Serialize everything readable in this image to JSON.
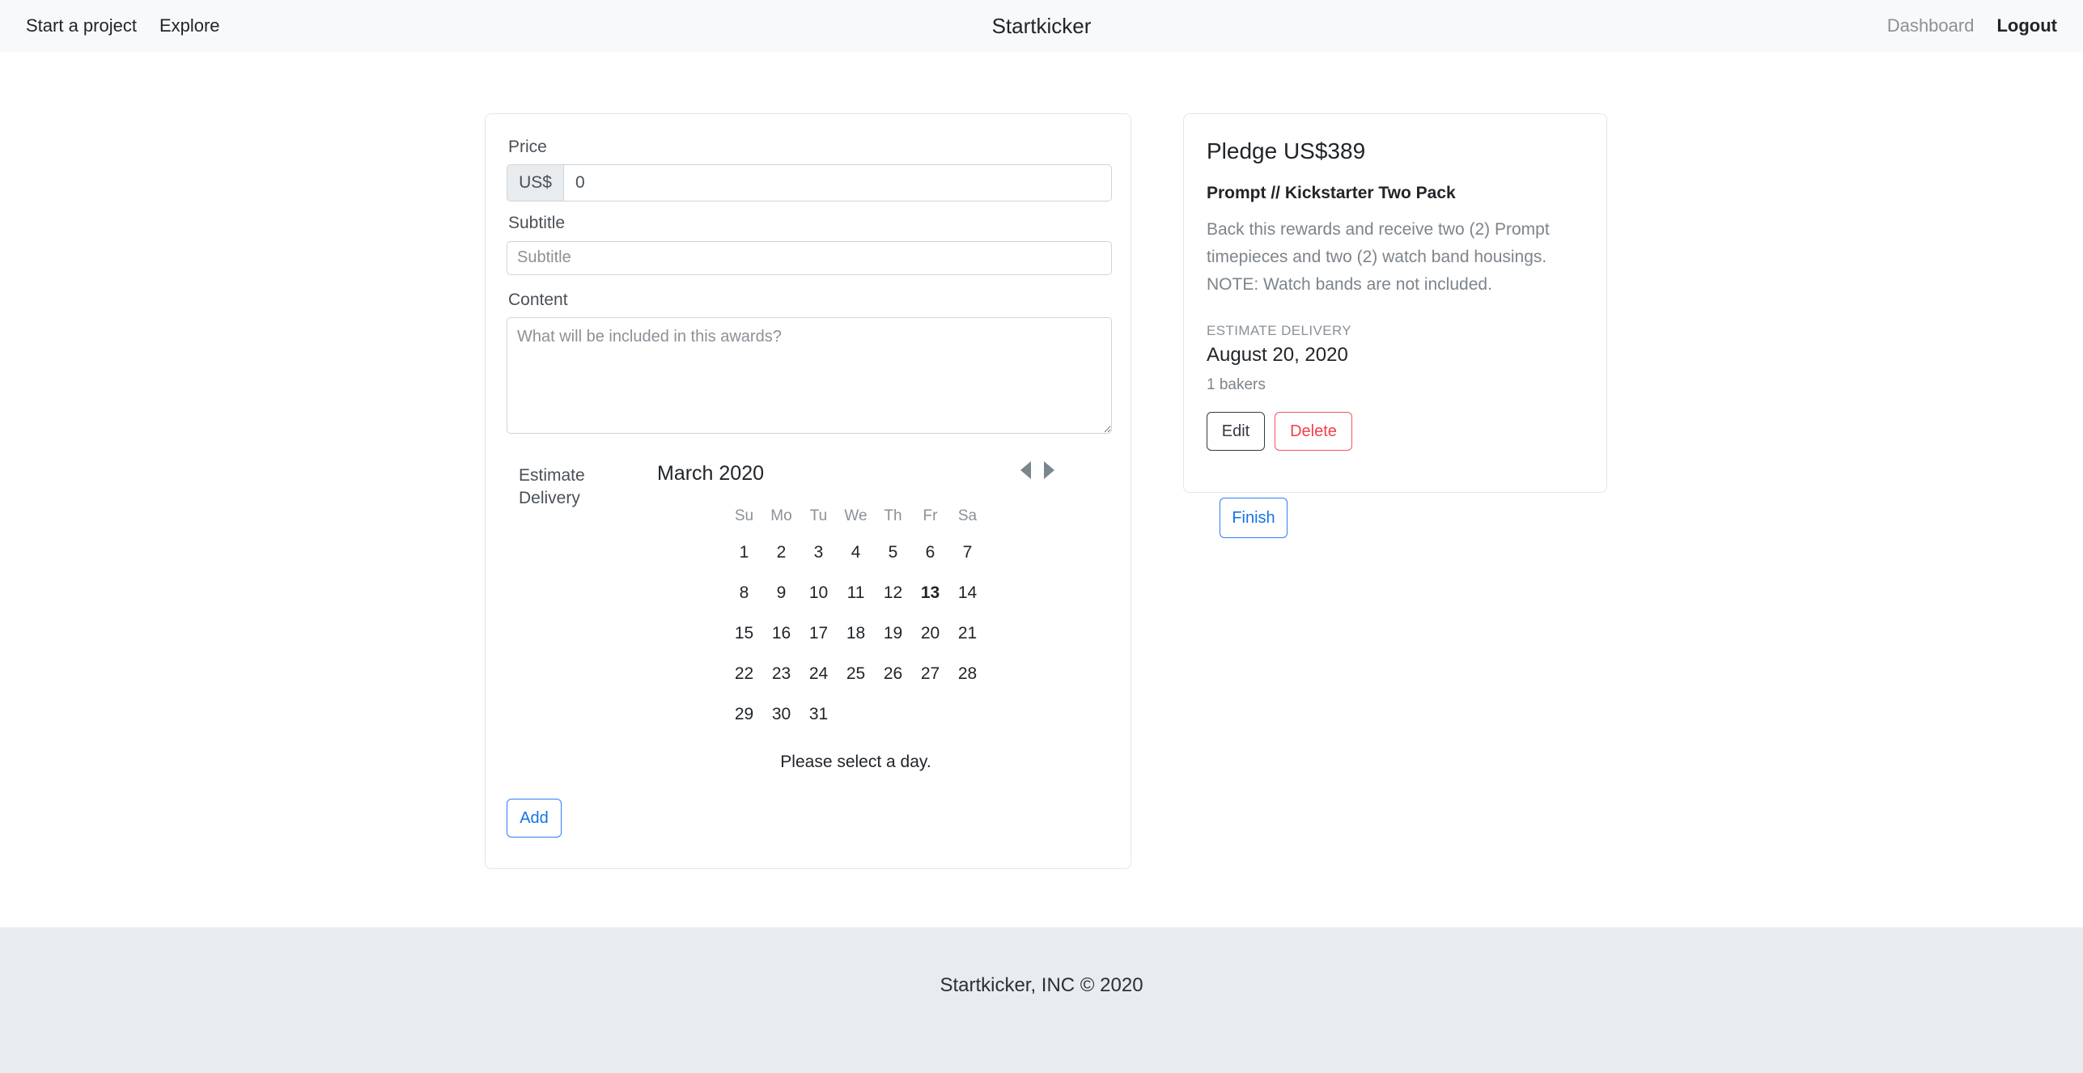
{
  "navbar": {
    "brand": "Startkicker",
    "left_links": [
      {
        "label": "Start a project",
        "name": "nav-start-a-project"
      },
      {
        "label": "Explore",
        "name": "nav-explore"
      }
    ],
    "right_links": [
      {
        "label": "Dashboard",
        "name": "nav-dashboard",
        "style": "muted"
      },
      {
        "label": "Logout",
        "name": "nav-logout",
        "style": "strong"
      }
    ]
  },
  "form": {
    "price_label": "Price",
    "price_prefix": "US$",
    "price_value": "0",
    "price_placeholder": "0",
    "subtitle_label": "Subtitle",
    "subtitle_value": "",
    "subtitle_placeholder": "Subtitle",
    "content_label": "Content",
    "content_value": "",
    "content_placeholder": "What will be included in this awards?",
    "delivery_label": "Estimate Delivery",
    "add_label": "Add"
  },
  "datepicker": {
    "caption": "March 2020",
    "prev_label": "Previous Month",
    "next_label": "Next Month",
    "weekdays": [
      "Su",
      "Mo",
      "Tu",
      "We",
      "Th",
      "Fr",
      "Sa"
    ],
    "footer_text": "Please select a day.",
    "today": 13,
    "first_enabled_day": 13,
    "leading_blanks": 0,
    "days_in_month": 31,
    "weeks": [
      [
        {
          "d": "1",
          "state": "disabled"
        },
        {
          "d": "2",
          "state": "disabled"
        },
        {
          "d": "3",
          "state": "disabled"
        },
        {
          "d": "4",
          "state": "disabled"
        },
        {
          "d": "5",
          "state": "disabled"
        },
        {
          "d": "6",
          "state": "disabled"
        },
        {
          "d": "7",
          "state": "disabled"
        }
      ],
      [
        {
          "d": "8",
          "state": "disabled"
        },
        {
          "d": "9",
          "state": "disabled"
        },
        {
          "d": "10",
          "state": "disabled"
        },
        {
          "d": "11",
          "state": "disabled"
        },
        {
          "d": "12",
          "state": "disabled"
        },
        {
          "d": "13",
          "state": "today"
        },
        {
          "d": "14",
          "state": "normal"
        }
      ],
      [
        {
          "d": "15",
          "state": "normal"
        },
        {
          "d": "16",
          "state": "normal"
        },
        {
          "d": "17",
          "state": "normal"
        },
        {
          "d": "18",
          "state": "normal"
        },
        {
          "d": "19",
          "state": "normal"
        },
        {
          "d": "20",
          "state": "normal"
        },
        {
          "d": "21",
          "state": "normal"
        }
      ],
      [
        {
          "d": "22",
          "state": "normal"
        },
        {
          "d": "23",
          "state": "normal"
        },
        {
          "d": "24",
          "state": "normal"
        },
        {
          "d": "25",
          "state": "normal"
        },
        {
          "d": "26",
          "state": "normal"
        },
        {
          "d": "27",
          "state": "normal"
        },
        {
          "d": "28",
          "state": "normal"
        }
      ],
      [
        {
          "d": "29",
          "state": "normal"
        },
        {
          "d": "30",
          "state": "normal"
        },
        {
          "d": "31",
          "state": "normal"
        },
        {
          "d": "",
          "state": "empty"
        },
        {
          "d": "",
          "state": "empty"
        },
        {
          "d": "",
          "state": "empty"
        },
        {
          "d": "",
          "state": "empty"
        }
      ]
    ]
  },
  "reward": {
    "pledge_title": "Pledge US$389",
    "name": "Prompt // Kickstarter Two Pack",
    "description": "Back this rewards and receive two (2) Prompt timepieces and two (2) watch band housings. NOTE: Watch bands are not included.",
    "delivery_kicker": "ESTIMATE DELIVERY",
    "delivery_date": "August 20, 2020",
    "backers": "1 bakers",
    "edit_label": "Edit",
    "delete_label": "Delete"
  },
  "actions": {
    "finish_label": "Finish"
  },
  "footer": {
    "text": "Startkicker, INC © 2020"
  },
  "colors": {
    "navbar_bg": "#f8f9fa",
    "footer_bg": "#e9ecef",
    "primary": "#1573e6",
    "danger": "#f0404c",
    "today": "#d0021b",
    "muted_text": "#7d848b",
    "border": "#ced4da",
    "card_border": "#e3e6ea"
  }
}
